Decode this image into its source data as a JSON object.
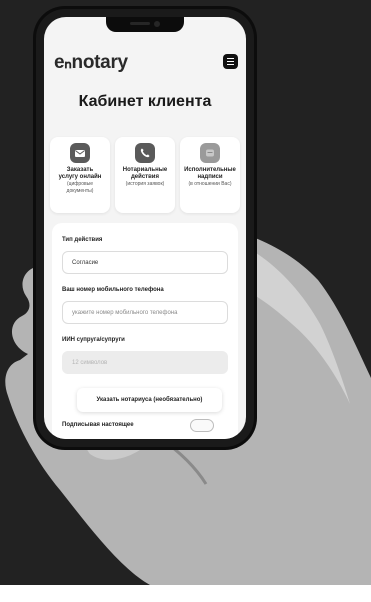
{
  "app": {
    "logo_text": "eₙnotary",
    "menu_icon": "menu-icon"
  },
  "page": {
    "title": "Кабинет клиента"
  },
  "cards": [
    {
      "icon": "mail-icon",
      "title_1": "Заказать",
      "title_2": "услугу онлайн",
      "sub_1": "(цифровые",
      "sub_2": "документы)"
    },
    {
      "icon": "phone-icon",
      "title_1": "Нотариальные",
      "title_2": "действия",
      "sub_1": "(история заявок)"
    },
    {
      "icon": "document-icon",
      "title_1": "Исполнительные",
      "title_2": "надписи",
      "sub_1": "(в отношении Вас)"
    }
  ],
  "form": {
    "action_type_label": "Тип действия",
    "action_type_value": "Согласие",
    "phone_label": "Ваш номер мобильного телефона",
    "phone_placeholder": "укажите номер мобильного телефона",
    "iin_label": "ИИН супруга/супруги",
    "iin_placeholder": "12 символов",
    "notary_button": "Указать нотариуса (необязательно)",
    "consent_text": "Подписывая настоящее"
  },
  "colors": {
    "background": "#222222",
    "screen": "#f4f4f4",
    "accent": "#111111"
  }
}
